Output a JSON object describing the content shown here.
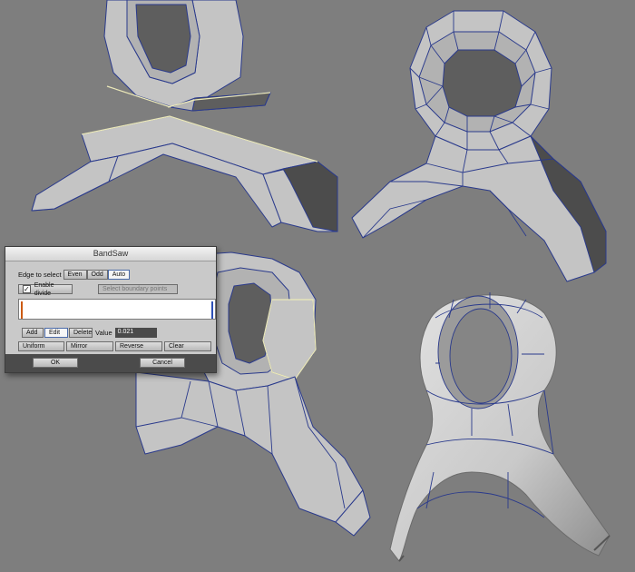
{
  "dialog": {
    "title": "BandSaw",
    "edge_select_label": "Edge to select",
    "edge_options": [
      "Even",
      "Odd",
      "Auto"
    ],
    "edge_selected": "Auto",
    "enable_divide_label": "Enable divide",
    "enable_divide_checked": true,
    "select_boundary_label": "Select boundary points",
    "mode_buttons": [
      "Add",
      "Edit",
      "Delete"
    ],
    "mode_selected": "Edit",
    "value_label": "Value",
    "value": "0.021",
    "action_buttons": [
      "Uniform",
      "Mirror",
      "Reverse",
      "Clear"
    ],
    "ok_label": "OK",
    "cancel_label": "Cancel"
  },
  "colors": {
    "viewport_bg": "#7e7e7e",
    "wire": "#2a3a8c",
    "selection": "#ece9b8",
    "marker_left": "#cc5a10",
    "marker_right": "#2d4fb6"
  }
}
